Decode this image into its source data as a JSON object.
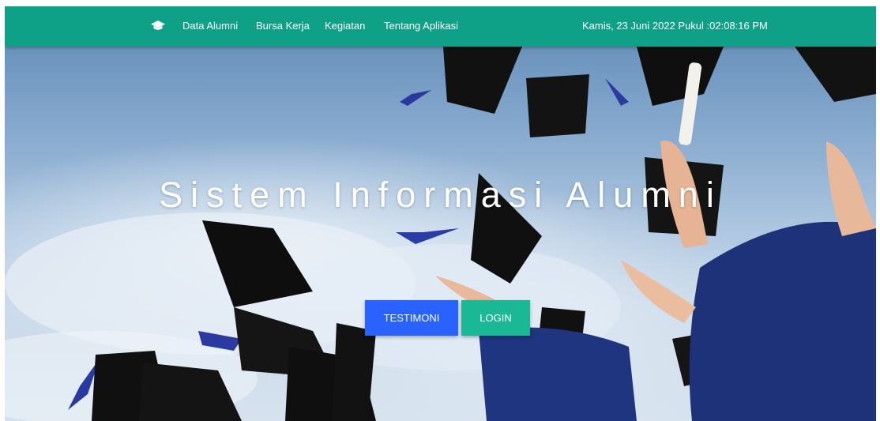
{
  "nav": {
    "brand_icon": "graduation-cap-icon",
    "links": [
      "Data Alumni",
      "Bursa Kerja",
      "Kegiatan",
      "Tentang Aplikasi"
    ],
    "clock": "Kamis, 23 Juni 2022 Pukul :02:08:16 PM"
  },
  "hero": {
    "title": "Sistem Informasi Alumni",
    "buttons": {
      "testimoni": "TESTIMONI",
      "login": "LOGIN"
    }
  },
  "colors": {
    "navbar": "#0fa088",
    "testimoni": "#2962ff",
    "login": "#1bb896"
  }
}
